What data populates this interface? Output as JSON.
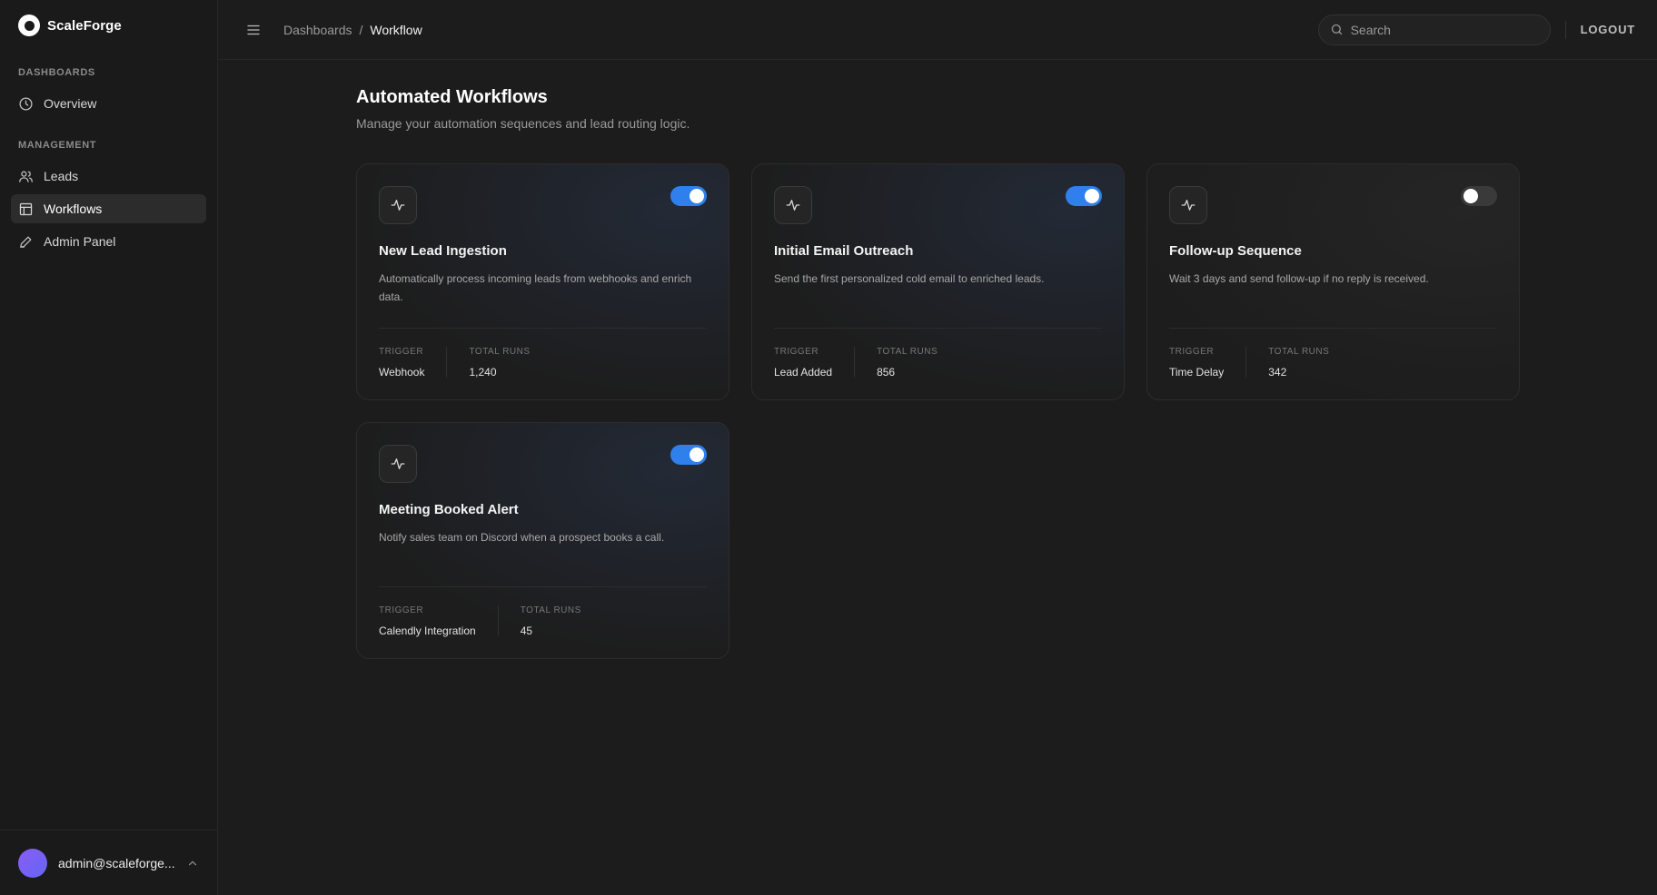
{
  "brand": {
    "name": "ScaleForge"
  },
  "sidebar": {
    "sections": [
      {
        "label": "DASHBOARDS",
        "items": [
          {
            "label": "Overview",
            "icon": "clock-icon"
          }
        ]
      },
      {
        "label": "MANAGEMENT",
        "items": [
          {
            "label": "Leads",
            "icon": "users-icon"
          },
          {
            "label": "Workflows",
            "icon": "layout-icon",
            "active": true
          },
          {
            "label": "Admin Panel",
            "icon": "pen-icon"
          }
        ]
      }
    ],
    "footer": {
      "email": "admin@scaleforge..."
    }
  },
  "topbar": {
    "breadcrumb": {
      "parent": "Dashboards",
      "separator": "/",
      "current": "Workflow"
    },
    "search": {
      "placeholder": "Search",
      "value": ""
    },
    "logout_label": "LOGOUT"
  },
  "page": {
    "title": "Automated Workflows",
    "subtitle": "Manage your automation sequences and lead routing logic."
  },
  "workflows": [
    {
      "title": "New Lead Ingestion",
      "description": "Automatically process incoming leads from webhooks and enrich data.",
      "enabled": true,
      "trigger_label": "TRIGGER",
      "trigger": "Webhook",
      "runs_label": "TOTAL RUNS",
      "runs": "1,240"
    },
    {
      "title": "Initial Email Outreach",
      "description": "Send the first personalized cold email to enriched leads.",
      "enabled": true,
      "trigger_label": "TRIGGER",
      "trigger": "Lead Added",
      "runs_label": "TOTAL RUNS",
      "runs": "856"
    },
    {
      "title": "Follow-up Sequence",
      "description": "Wait 3 days and send follow-up if no reply is received.",
      "enabled": false,
      "trigger_label": "TRIGGER",
      "trigger": "Time Delay",
      "runs_label": "TOTAL RUNS",
      "runs": "342"
    },
    {
      "title": "Meeting Booked Alert",
      "description": "Notify sales team on Discord when a prospect books a call.",
      "enabled": true,
      "trigger_label": "TRIGGER",
      "trigger": "Calendly Integration",
      "runs_label": "TOTAL RUNS",
      "runs": "45"
    }
  ],
  "colors": {
    "accent": "#2f80ed",
    "background": "#1c1c1c",
    "avatar": "#8b5cf6"
  }
}
